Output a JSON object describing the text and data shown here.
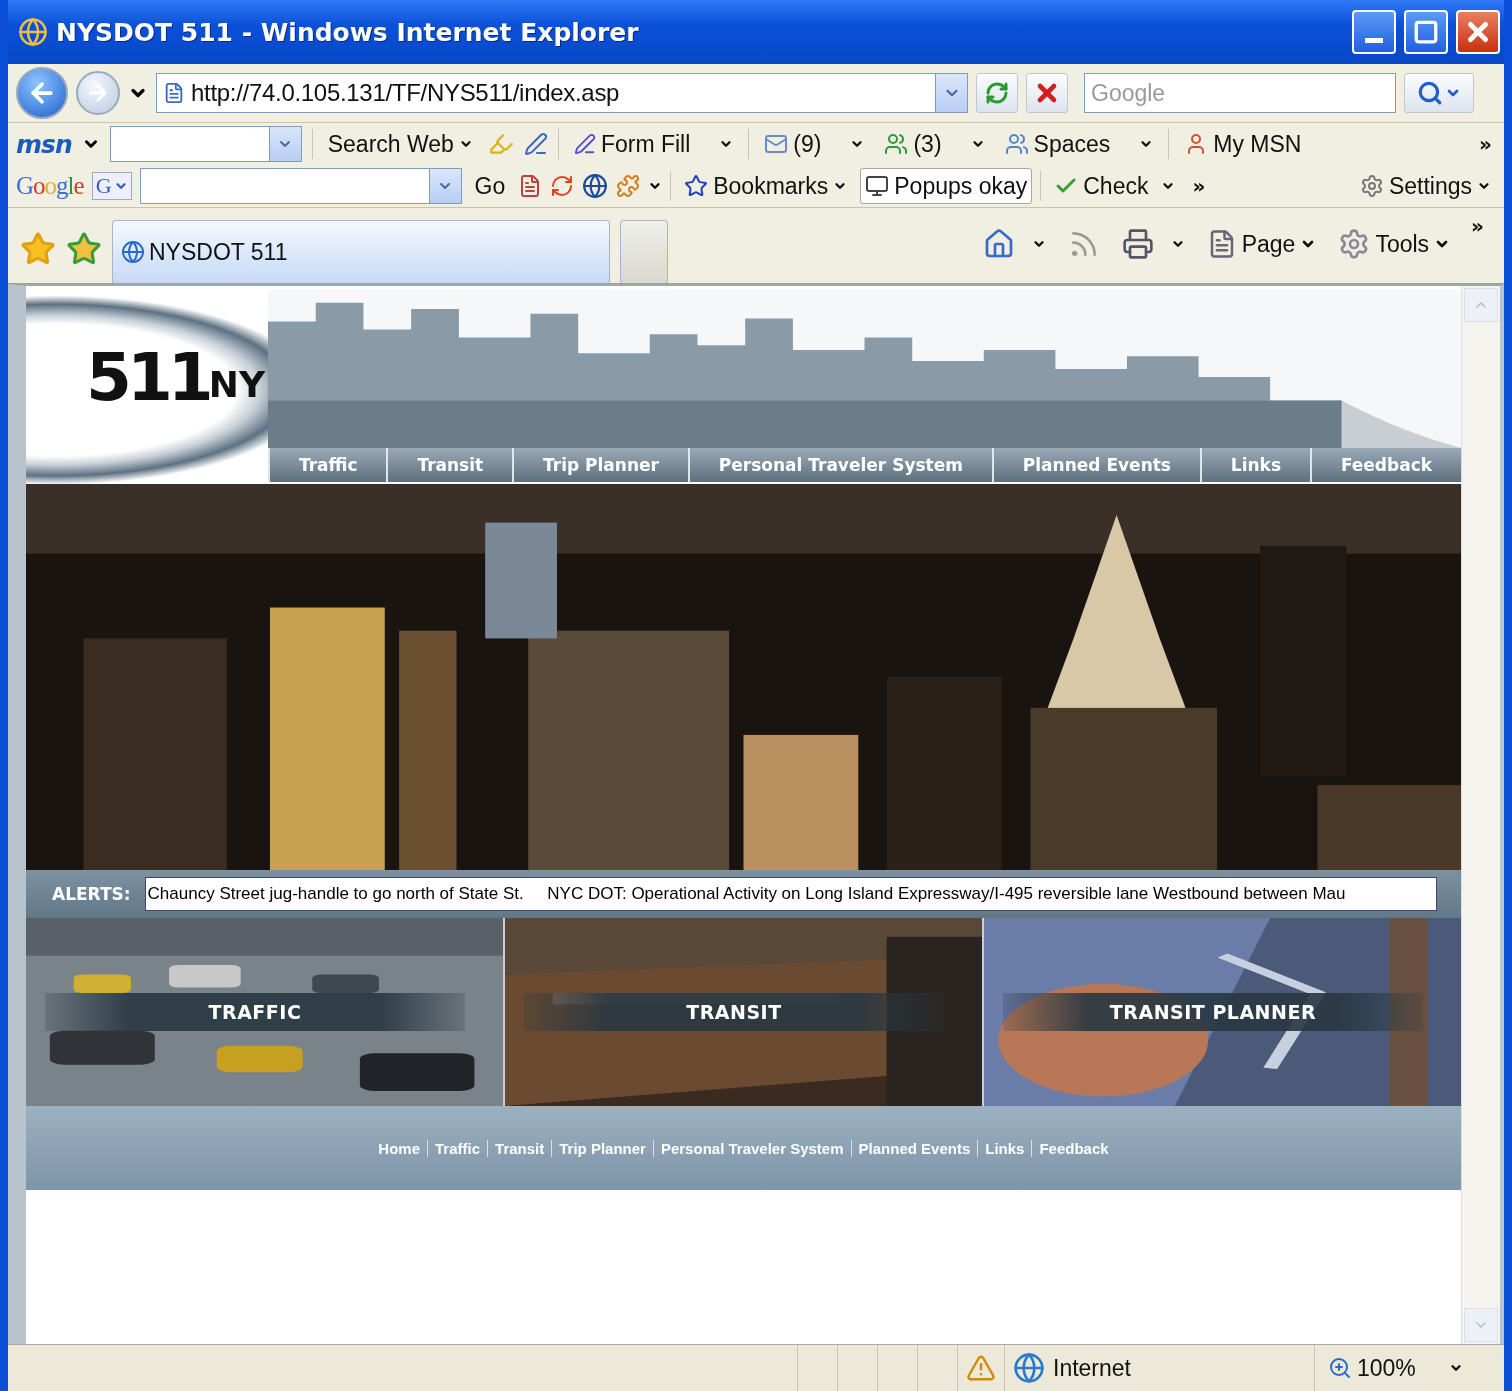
{
  "window": {
    "title": "NYSDOT 511 - Windows Internet Explorer"
  },
  "address_bar": {
    "url": "http://74.0.105.131/TF/NYS511/index.asp"
  },
  "search": {
    "placeholder": "Google"
  },
  "msn_toolbar": {
    "logo": "msn",
    "search_button": "Search Web",
    "form_fill": "Form Fill",
    "mail_count": "(9)",
    "contacts_count": "(3)",
    "spaces": "Spaces",
    "my_msn": "My MSN",
    "more": "»"
  },
  "google_toolbar": {
    "logo": "Google",
    "field_badge": "G",
    "go": "Go",
    "bookmarks": "Bookmarks",
    "popups": "Popups okay",
    "check": "Check",
    "more": "»",
    "settings": "Settings"
  },
  "tabs": [
    {
      "label": "NYSDOT 511",
      "selected": true
    }
  ],
  "command_bar": {
    "page": "Page",
    "tools": "Tools",
    "more": "»"
  },
  "site": {
    "logo": {
      "number": "511",
      "suffix": "NY"
    },
    "nav": [
      "Traffic",
      "Transit",
      "Trip Planner",
      "Personal Traveler System",
      "Planned Events",
      "Links",
      "Feedback"
    ],
    "alerts": {
      "label": "ALERTS:",
      "text": "Chauncy Street jug-handle to go north of State St.     NYC DOT: Operational Activity on Long Island Expressway/I-495 reversible lane Westbound between Mau"
    },
    "tiles": [
      "TRAFFIC",
      "TRANSIT",
      "TRANSIT PLANNER"
    ],
    "footer_links": [
      "Home",
      "Traffic",
      "Transit",
      "Trip Planner",
      "Personal Traveler System",
      "Planned Events",
      "Links",
      "Feedback"
    ]
  },
  "status_bar": {
    "zone": "Internet",
    "zoom": "100%"
  }
}
